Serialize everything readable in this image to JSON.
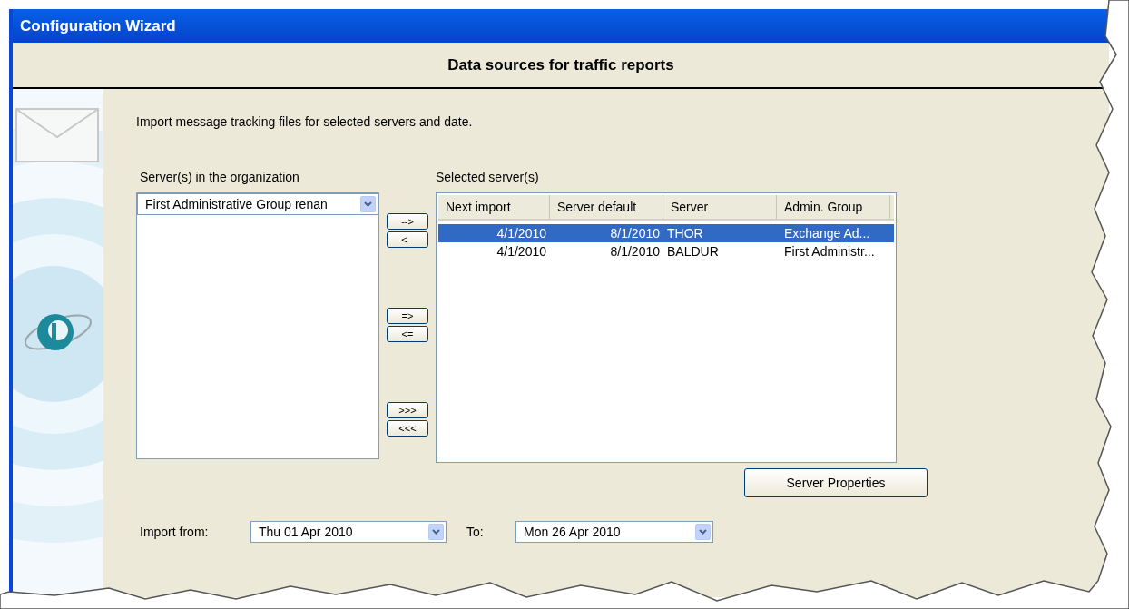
{
  "window": {
    "title": "Configuration Wizard"
  },
  "header": {
    "title": "Data sources for traffic reports"
  },
  "description": "Import message tracking files for selected servers and date.",
  "available": {
    "label": "Server(s) in the organization",
    "group_combo": {
      "value": "First Administrative Group renan"
    }
  },
  "move_buttons": [
    {
      "label": "-->"
    },
    {
      "label": "<--"
    },
    {
      "label": "=>"
    },
    {
      "label": "<="
    },
    {
      "label": ">>>"
    },
    {
      "label": "<<<"
    }
  ],
  "selected": {
    "label": "Selected server(s)",
    "columns": [
      "Next import",
      "Server default",
      "Server",
      "Admin. Group"
    ],
    "rows": [
      {
        "next_import": "4/1/2010",
        "server_default": "8/1/2010",
        "server": "THOR",
        "admin_group": "Exchange Ad...",
        "selected": true
      },
      {
        "next_import": "4/1/2010",
        "server_default": "8/1/2010",
        "server": "BALDUR",
        "admin_group": "First Administr...",
        "selected": false
      }
    ]
  },
  "server_properties_button": {
    "label": "Server Properties"
  },
  "import_from": {
    "label": "Import from:",
    "value": "Thu 01 Apr 2010"
  },
  "import_to": {
    "label": "To:",
    "value": "Mon 26 Apr 2010"
  }
}
